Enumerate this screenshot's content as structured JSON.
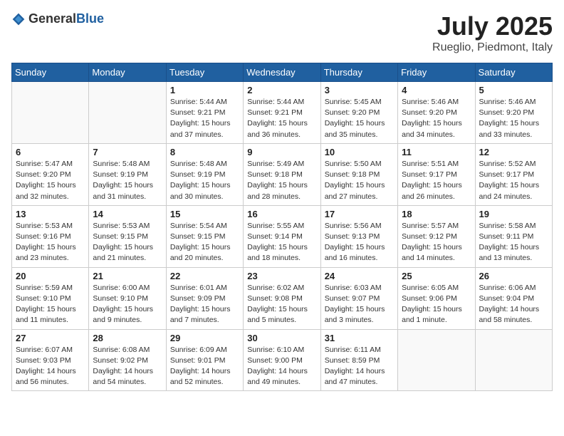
{
  "header": {
    "logo_general": "General",
    "logo_blue": "Blue",
    "month": "July 2025",
    "location": "Rueglio, Piedmont, Italy"
  },
  "weekdays": [
    "Sunday",
    "Monday",
    "Tuesday",
    "Wednesday",
    "Thursday",
    "Friday",
    "Saturday"
  ],
  "weeks": [
    [
      {
        "day": "",
        "info": ""
      },
      {
        "day": "",
        "info": ""
      },
      {
        "day": "1",
        "info": "Sunrise: 5:44 AM\nSunset: 9:21 PM\nDaylight: 15 hours and 37 minutes."
      },
      {
        "day": "2",
        "info": "Sunrise: 5:44 AM\nSunset: 9:21 PM\nDaylight: 15 hours and 36 minutes."
      },
      {
        "day": "3",
        "info": "Sunrise: 5:45 AM\nSunset: 9:20 PM\nDaylight: 15 hours and 35 minutes."
      },
      {
        "day": "4",
        "info": "Sunrise: 5:46 AM\nSunset: 9:20 PM\nDaylight: 15 hours and 34 minutes."
      },
      {
        "day": "5",
        "info": "Sunrise: 5:46 AM\nSunset: 9:20 PM\nDaylight: 15 hours and 33 minutes."
      }
    ],
    [
      {
        "day": "6",
        "info": "Sunrise: 5:47 AM\nSunset: 9:20 PM\nDaylight: 15 hours and 32 minutes."
      },
      {
        "day": "7",
        "info": "Sunrise: 5:48 AM\nSunset: 9:19 PM\nDaylight: 15 hours and 31 minutes."
      },
      {
        "day": "8",
        "info": "Sunrise: 5:48 AM\nSunset: 9:19 PM\nDaylight: 15 hours and 30 minutes."
      },
      {
        "day": "9",
        "info": "Sunrise: 5:49 AM\nSunset: 9:18 PM\nDaylight: 15 hours and 28 minutes."
      },
      {
        "day": "10",
        "info": "Sunrise: 5:50 AM\nSunset: 9:18 PM\nDaylight: 15 hours and 27 minutes."
      },
      {
        "day": "11",
        "info": "Sunrise: 5:51 AM\nSunset: 9:17 PM\nDaylight: 15 hours and 26 minutes."
      },
      {
        "day": "12",
        "info": "Sunrise: 5:52 AM\nSunset: 9:17 PM\nDaylight: 15 hours and 24 minutes."
      }
    ],
    [
      {
        "day": "13",
        "info": "Sunrise: 5:53 AM\nSunset: 9:16 PM\nDaylight: 15 hours and 23 minutes."
      },
      {
        "day": "14",
        "info": "Sunrise: 5:53 AM\nSunset: 9:15 PM\nDaylight: 15 hours and 21 minutes."
      },
      {
        "day": "15",
        "info": "Sunrise: 5:54 AM\nSunset: 9:15 PM\nDaylight: 15 hours and 20 minutes."
      },
      {
        "day": "16",
        "info": "Sunrise: 5:55 AM\nSunset: 9:14 PM\nDaylight: 15 hours and 18 minutes."
      },
      {
        "day": "17",
        "info": "Sunrise: 5:56 AM\nSunset: 9:13 PM\nDaylight: 15 hours and 16 minutes."
      },
      {
        "day": "18",
        "info": "Sunrise: 5:57 AM\nSunset: 9:12 PM\nDaylight: 15 hours and 14 minutes."
      },
      {
        "day": "19",
        "info": "Sunrise: 5:58 AM\nSunset: 9:11 PM\nDaylight: 15 hours and 13 minutes."
      }
    ],
    [
      {
        "day": "20",
        "info": "Sunrise: 5:59 AM\nSunset: 9:10 PM\nDaylight: 15 hours and 11 minutes."
      },
      {
        "day": "21",
        "info": "Sunrise: 6:00 AM\nSunset: 9:10 PM\nDaylight: 15 hours and 9 minutes."
      },
      {
        "day": "22",
        "info": "Sunrise: 6:01 AM\nSunset: 9:09 PM\nDaylight: 15 hours and 7 minutes."
      },
      {
        "day": "23",
        "info": "Sunrise: 6:02 AM\nSunset: 9:08 PM\nDaylight: 15 hours and 5 minutes."
      },
      {
        "day": "24",
        "info": "Sunrise: 6:03 AM\nSunset: 9:07 PM\nDaylight: 15 hours and 3 minutes."
      },
      {
        "day": "25",
        "info": "Sunrise: 6:05 AM\nSunset: 9:06 PM\nDaylight: 15 hours and 1 minute."
      },
      {
        "day": "26",
        "info": "Sunrise: 6:06 AM\nSunset: 9:04 PM\nDaylight: 14 hours and 58 minutes."
      }
    ],
    [
      {
        "day": "27",
        "info": "Sunrise: 6:07 AM\nSunset: 9:03 PM\nDaylight: 14 hours and 56 minutes."
      },
      {
        "day": "28",
        "info": "Sunrise: 6:08 AM\nSunset: 9:02 PM\nDaylight: 14 hours and 54 minutes."
      },
      {
        "day": "29",
        "info": "Sunrise: 6:09 AM\nSunset: 9:01 PM\nDaylight: 14 hours and 52 minutes."
      },
      {
        "day": "30",
        "info": "Sunrise: 6:10 AM\nSunset: 9:00 PM\nDaylight: 14 hours and 49 minutes."
      },
      {
        "day": "31",
        "info": "Sunrise: 6:11 AM\nSunset: 8:59 PM\nDaylight: 14 hours and 47 minutes."
      },
      {
        "day": "",
        "info": ""
      },
      {
        "day": "",
        "info": ""
      }
    ]
  ]
}
